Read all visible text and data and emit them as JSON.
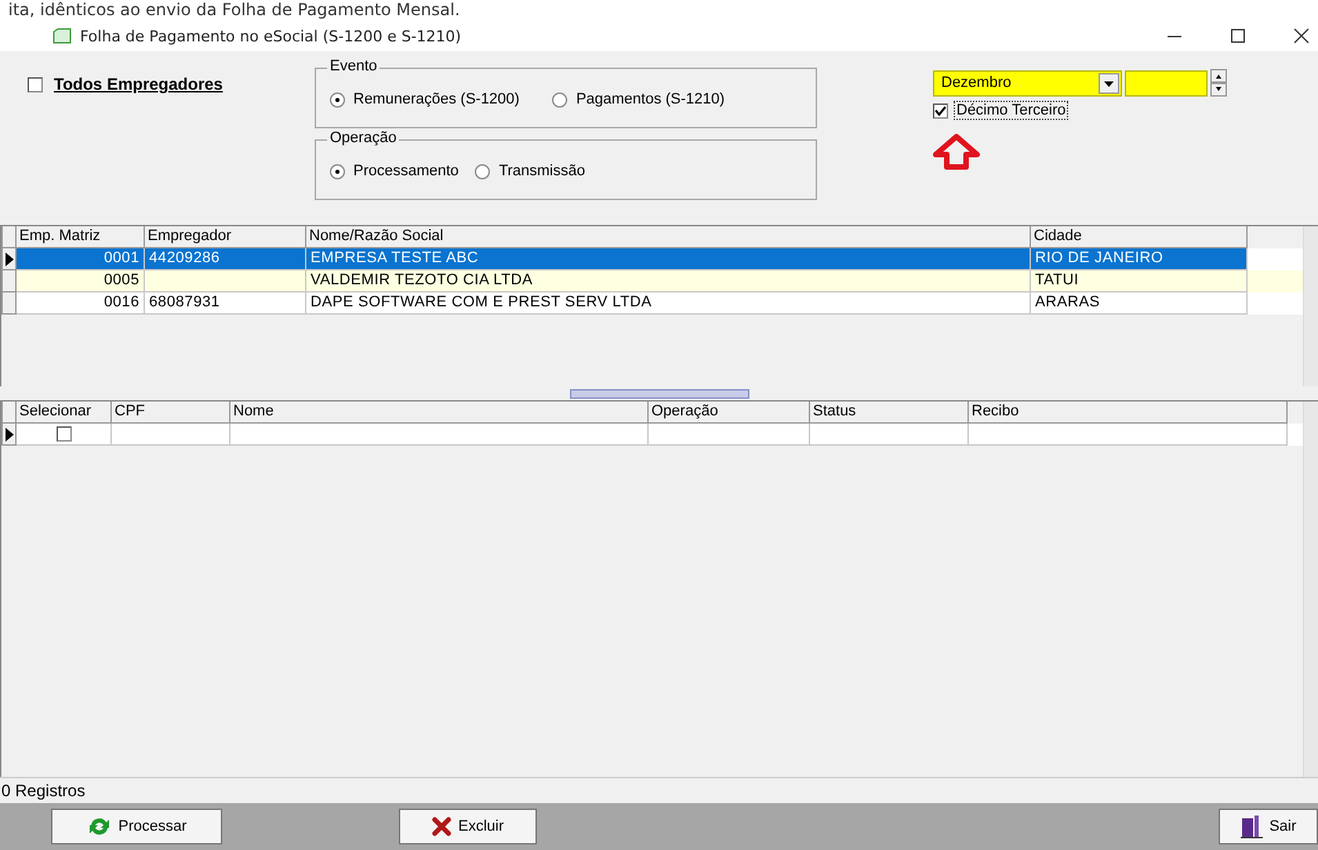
{
  "caption": "ita, idênticos ao envio da Folha de Pagamento Mensal.",
  "window": {
    "title": "Folha de Pagamento no eSocial (S-1200 e S-1210)"
  },
  "todos_empregadores": {
    "label": "Todos Empregadores",
    "checked": false
  },
  "evento": {
    "legend": "Evento",
    "options": [
      {
        "label": "Remunerações (S-1200)",
        "selected": true
      },
      {
        "label": "Pagamentos (S-1210)",
        "selected": false
      }
    ]
  },
  "operacao": {
    "legend": "Operação",
    "options": [
      {
        "label": "Processamento",
        "selected": true
      },
      {
        "label": "Transmissão",
        "selected": false
      }
    ]
  },
  "month": {
    "value": "Dezembro"
  },
  "decimo_terceiro": {
    "label": "Décimo Terceiro",
    "checked": true
  },
  "employers": {
    "columns": [
      "Emp. Matriz",
      "Empregador",
      "Nome/Razão Social",
      "Cidade"
    ],
    "rows": [
      {
        "cells": [
          "0001",
          "44209286",
          "EMPRESA TESTE ABC",
          "RIO DE JANEIRO"
        ],
        "selected": true
      },
      {
        "cells": [
          "0005",
          "",
          "VALDEMIR TEZOTO CIA LTDA",
          "TATUI"
        ],
        "selected": false
      },
      {
        "cells": [
          "0016",
          "68087931",
          "DAPE SOFTWARE COM E PREST SERV LTDA",
          "ARARAS"
        ],
        "selected": false
      }
    ]
  },
  "events": {
    "columns": [
      "Selecionar",
      "CPF",
      "Nome",
      "Operação",
      "Status",
      "Recibo"
    ],
    "rows": [
      {
        "checked": false,
        "selected": true
      }
    ]
  },
  "status_bar": "0 Registros",
  "buttons": [
    {
      "label": "Processar",
      "kind": "process"
    },
    {
      "label": "Excluir",
      "kind": "delete"
    },
    {
      "label": "Sair",
      "kind": "exit"
    }
  ]
}
